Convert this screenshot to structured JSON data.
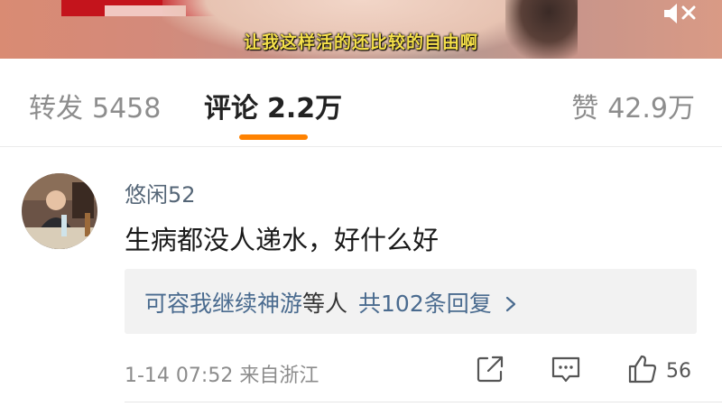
{
  "video": {
    "subtitle": "让我这样活的还比较的自由啊",
    "mute_icon": "speaker-muted-icon"
  },
  "tabs": {
    "repost": {
      "label": "转发",
      "count": "5458"
    },
    "comments": {
      "label": "评论",
      "count": "2.2万"
    },
    "likes": {
      "label": "赞",
      "count": "42.9万"
    },
    "active": "comments",
    "indicator_color": "#ff8200"
  },
  "comment": {
    "username": "悠闲52",
    "text": "生病都没人递水，好什么好",
    "replies": {
      "first_replier": "可容我继续神游",
      "first_reply_text": "等人",
      "total": "共102条回复"
    },
    "timestamp": "1-14 07:52",
    "location": "来自浙江",
    "likes": "56",
    "actions": [
      "share-icon",
      "comment-icon",
      "thumbs-up-icon"
    ]
  },
  "colors": {
    "username": "#556677",
    "link": "#4a6b8f",
    "accent": "#ff8200"
  }
}
